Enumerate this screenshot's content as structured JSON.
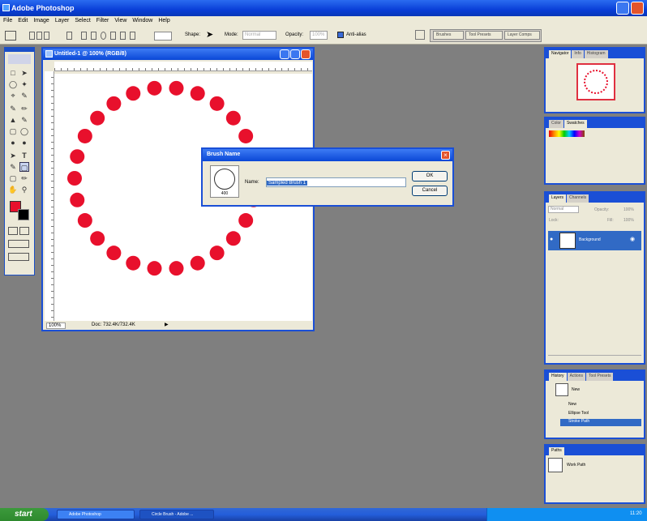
{
  "app": {
    "title": "Adobe Photoshop"
  },
  "menu": [
    "File",
    "Edit",
    "Image",
    "Layer",
    "Select",
    "Filter",
    "View",
    "Window",
    "Help"
  ],
  "options_bar": {
    "shape_label": "Shape:",
    "mode_label": "Mode:",
    "mode_value": "Normal",
    "opacity_label": "Opacity:",
    "opacity_value": "100%",
    "antialias_label": "Anti-alias",
    "checked": true
  },
  "palette_well": {
    "tabs": [
      "Brushes",
      "Tool Presets",
      "Layer Comps"
    ]
  },
  "document": {
    "title": "Untitled-1 @ 100% (RGB/8)",
    "zoom": "100%",
    "doc_size": "Doc: 732.4K/732.4K",
    "dots": 26,
    "dot_color": "#e8102c"
  },
  "dialog": {
    "title": "Brush Name",
    "name_label": "Name:",
    "name_value": "Sampled Brush 1",
    "brush_size": "400",
    "ok": "OK",
    "cancel": "Cancel"
  },
  "panels": {
    "navigator": {
      "tabs": [
        "Navigator",
        "Info",
        "Histogram"
      ]
    },
    "color": {
      "tabs": [
        "Color",
        "Swatches"
      ]
    },
    "layers": {
      "tabs": [
        "Layers",
        "Channels"
      ],
      "mode": "Normal",
      "opacity_label": "Opacity:",
      "opacity_value": "100%",
      "lock_label": "Lock:",
      "fill_label": "Fill:",
      "fill_value": "100%",
      "layer_name": "Background"
    },
    "history": {
      "tabs": [
        "History",
        "Actions",
        "Tool Presets"
      ],
      "items": [
        "New",
        "Ellipse Tool",
        "Stroke Path"
      ],
      "snapshot": "New"
    },
    "paths": {
      "tabs": [
        "Paths"
      ],
      "item": "Work Path"
    }
  },
  "taskbar": {
    "start": "start",
    "tasks": [
      "Adobe Photoshop",
      "Circle Brush - Adobe ..."
    ],
    "time": "11:20"
  },
  "colors": {
    "foreground": "#e8102c",
    "background": "#000000",
    "accent": "#1a4fd6"
  }
}
